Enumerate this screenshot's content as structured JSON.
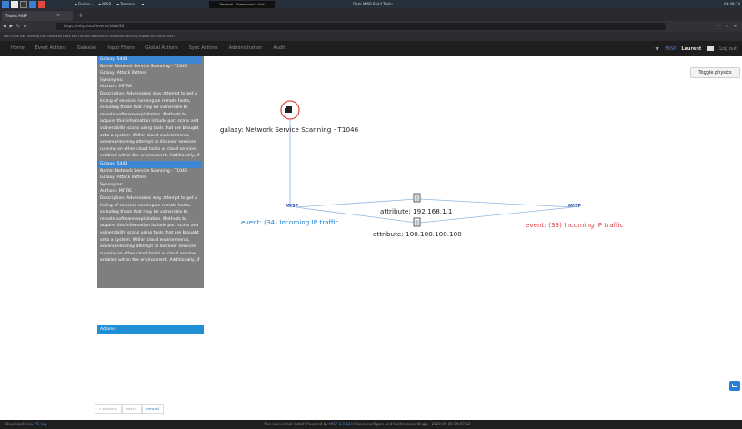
{
  "os": {
    "tasks": "▪ Firefox - ...   ▪ MISP ...   ▪ Terminal ...   ▪ ...",
    "window_title": "Terminal - Greenbone & Kali",
    "center_text": "Dark MISP Build Trello",
    "clock": "09:48:14"
  },
  "browser": {
    "tab_title": "Thales MISP",
    "url": "https://misp.local/events/view/34",
    "bookmarks": "Kali Linux   Kali Training   Kali Tools   Kali Docs   Kali Forums   NetHunter   Offensive Security   Exploit-DB   GHDB   MSFU"
  },
  "nav": {
    "items": [
      "Home",
      "Event Actions",
      "Galaxies",
      "Input Filters",
      "Global Actions",
      "Sync Actions",
      "Administration",
      "Audit"
    ],
    "brand": "MISP",
    "user": "Laurent",
    "logout": "Log out"
  },
  "tooltip": {
    "blocks": [
      {
        "galaxy_id": "Galaxy: 5443",
        "name": "Name: Network Service Scanning - T1046",
        "galaxy": "Galaxy: Attack Pattern",
        "synonyms": "Synonyms:",
        "authors": "Authors: MITRE",
        "description": "Description: Adversaries may attempt to get a listing of services running on remote hosts, including those that may be vulnerable to remote software exploitation. Methods to acquire this information include port scans and vulnerability scans using tools that are brought onto a system. Within cloud environments, adversaries may attempt to discover services running on other cloud hosts or cloud services enabled within the environment. Additionally, if"
      },
      {
        "galaxy_id": "Galaxy: 5443",
        "name": "Name: Network Service Scanning - T1046",
        "galaxy": "Galaxy: Attack Pattern",
        "synonyms": "Synonyms:",
        "authors": "Authors: MITRE",
        "description": "Description: Adversaries may attempt to get a listing of services running on remote hosts, including those that may be vulnerable to remote software exploitation. Methods to acquire this information include port scans and vulnerability scans using tools that are brought onto a system. Within cloud environments, adversaries may attempt to discover services running on other cloud hosts or cloud services enabled within the environment. Additionally, if"
      }
    ],
    "actions_label": "Actions"
  },
  "toggle_physics": "Toggle physics",
  "graph": {
    "galaxy_label": "galaxy: Network Service Scanning - T1046",
    "misp_left": "MISP",
    "misp_right": "MISP",
    "event_left": "event: (34) Incoming IP traffic",
    "event_right": "event: (33) Incoming IP traffic",
    "attr_top": "attribute: 192.168.1.1",
    "attr_bottom": "attribute: 100.100.100.100",
    "colors": {
      "event_left": "#1e7fd6",
      "event_right": "#e0393e",
      "edge": "#8fb6e3",
      "node_ring": "#e04a3f"
    }
  },
  "pagination": [
    "« previous",
    "next »",
    "view all"
  ],
  "footer": {
    "download_prefix": "Download: ",
    "download_link": "Gnu PG key",
    "notice_prefix": "This is an initial install! Powered by ",
    "notice_link": "MISP 2.4.124",
    "notice_suffix": " Please configure and harden accordingly - 2020-05-05 09:07:12"
  }
}
